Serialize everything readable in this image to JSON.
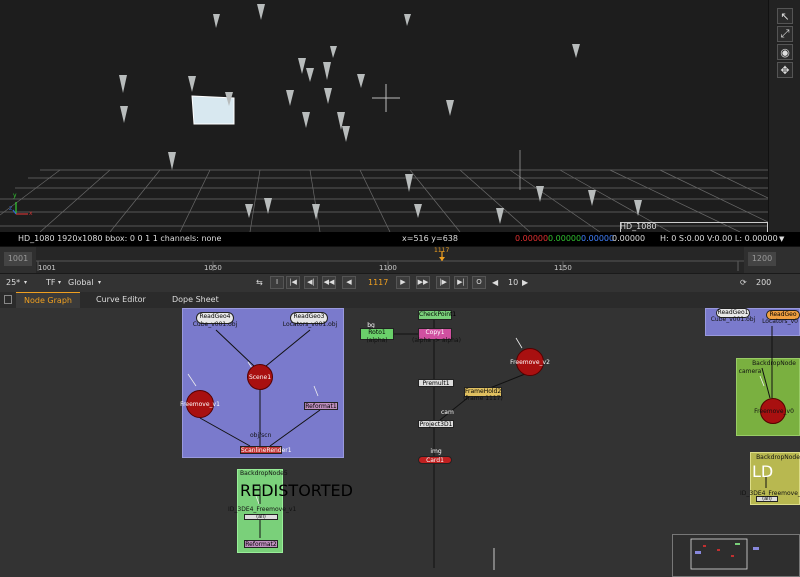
{
  "viewer": {
    "format_label": "HD_1080",
    "axis_x": "x",
    "axis_y": "y",
    "axis_z": "z"
  },
  "viewer_tools": [
    "select-tool",
    "rotate-tool",
    "pivot-tool",
    "move-tool"
  ],
  "info_bar": {
    "format": "HD_1080 1920x1080  bbox: 0 0 1 1 channels: none",
    "coords": "x=516 y=638",
    "r": "0.00000",
    "g": "0.00000",
    "b": "0.00000",
    "a": "0.00000",
    "hsvl": "H:  0 S:0.00 V:0.00   L: 0.00000",
    "colors": {
      "r": "#e03030",
      "g": "#30c030",
      "b": "#4080ff",
      "a": "#dddddd"
    }
  },
  "timeline": {
    "in_frame": "1001",
    "out_frame": "1200",
    "ticks": [
      "1001",
      "1050",
      "1100",
      "1150",
      "1200"
    ],
    "current_marker": "1117"
  },
  "controls": {
    "fps": "25*",
    "tf": "TF",
    "range": "Global",
    "current_frame": "1117",
    "step": "10",
    "end": "200",
    "buttons": [
      "I",
      "|◀",
      "◀|",
      "◀◀",
      "◀",
      "▶",
      "▶▶",
      "|▶",
      "▶|",
      "O"
    ]
  },
  "tabs": [
    "Node Graph",
    "Curve Editor",
    "Dope Sheet"
  ],
  "graph": {
    "readgeo4": {
      "name": "ReadGeo4",
      "file": "Cube_v001.obj"
    },
    "readgeo3": {
      "name": "ReadGeo3",
      "file": "Locators_v001.obj"
    },
    "scene1": "Scene1",
    "freemove_v1": "Freemove_v1",
    "reformat1": "Reformat1",
    "scanline_render": "ScanlineRender1",
    "obj_scene": "obj/scn",
    "roto1": {
      "name": "Roto1",
      "sub": "(alpha)"
    },
    "copy1": {
      "name": "Copy1",
      "sub": "(alpha -> alpha)"
    },
    "checkpoint": "CheckPoint1",
    "bg_label": "bg",
    "freemove_v2": "Freemove_v2",
    "premult": "Premult1",
    "framehold": {
      "name": "FrameHold2",
      "sub": "(frame 1117)"
    },
    "cam_label": "cam",
    "project3d": "Project3D1",
    "img_label": "img",
    "card1": "Card1",
    "backdrop5": "BackdropNode5",
    "redistorted": "REDISTORTED",
    "tde_node": "ID_3DE4_Freemove_v1",
    "tde_sub": "(all)",
    "reformat2": "Reformat2",
    "readgeo1": {
      "name": "ReadGeo1",
      "file": "Cube_v001.obj"
    },
    "readgeo_right": {
      "name": "ReadGeo",
      "file": "Locators_v0"
    },
    "backdrop_right1": "BackdropNode",
    "camera_label": "camera",
    "freemove_right": "Freemove_v0",
    "backdrop_right2": "BackdropNode",
    "ld_text": "LD",
    "tde_right": "ID_3DE4_Freemove_v",
    "tde_right_sub": "(all)"
  }
}
